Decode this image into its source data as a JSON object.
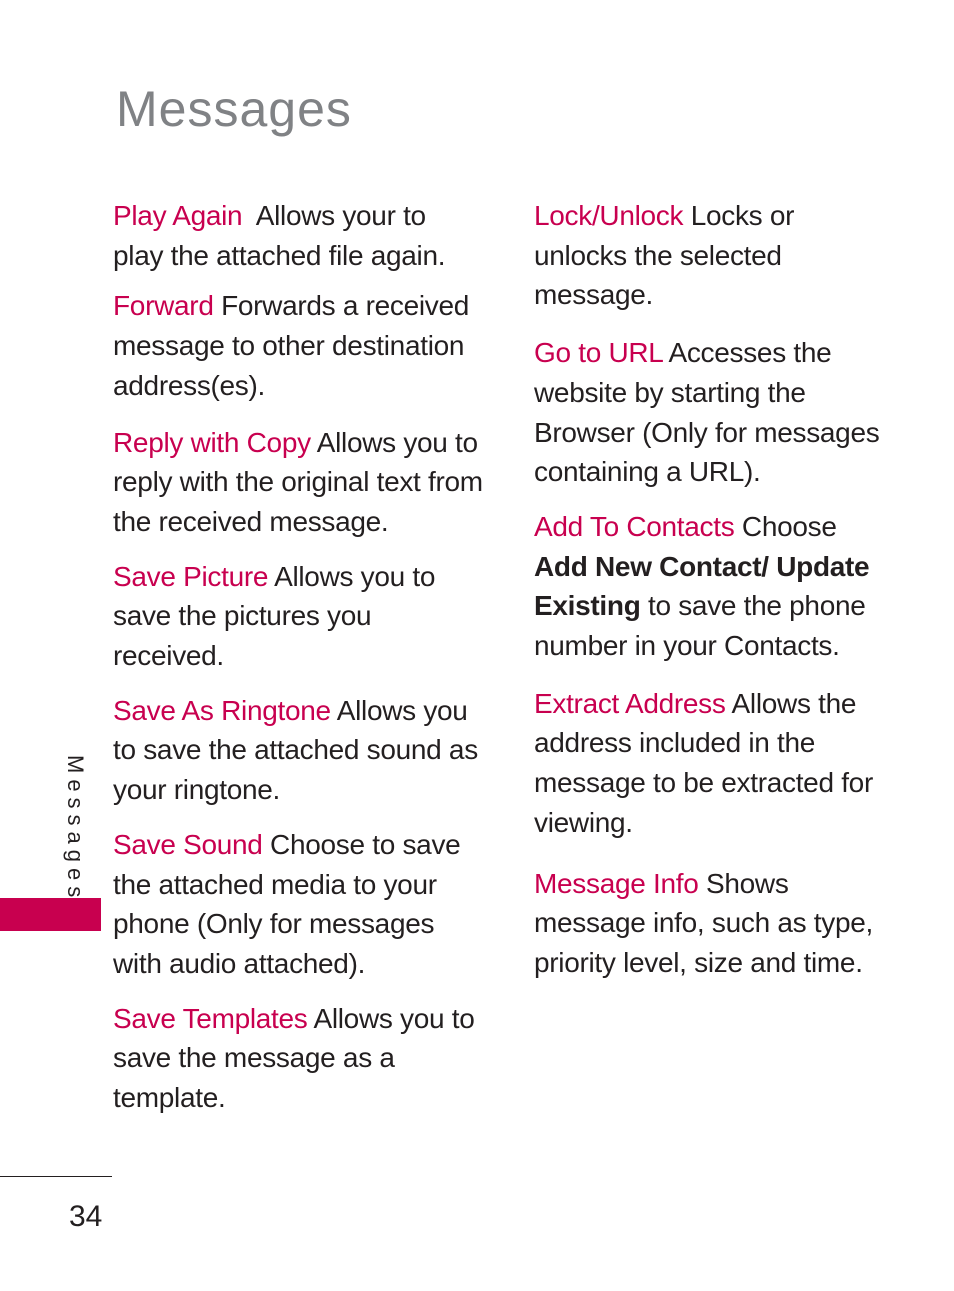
{
  "page": {
    "title": "Messages",
    "side_label": "Messages",
    "page_number": "34",
    "accent_color": "#c8004f"
  },
  "left_column": [
    {
      "term": "Play Again",
      "desc": "  Allows your to play the attached file again."
    },
    {
      "term": "Forward",
      "desc": " Forwards a received message to other destination address(es)."
    },
    {
      "term": "Reply with Copy",
      "desc": " Allows you to reply with the original text from the received message."
    },
    {
      "term": "Save Picture",
      "desc": " Allows you to save the pictures you received."
    },
    {
      "term": "Save As Ringtone",
      "desc": " Allows you to save the attached sound as your ringtone."
    },
    {
      "term": "Save Sound",
      "desc": " Choose to save the attached media to your phone (Only for messages with audio attached)."
    },
    {
      "term": "Save Templates",
      "desc": " Allows you to save the message as a template."
    }
  ],
  "right_column": [
    {
      "term": "Lock/Unlock",
      "desc": " Locks or unlocks the selected message."
    },
    {
      "term": "Go to URL",
      "desc": " Accesses the website by starting the Browser (Only for messages containing a URL)."
    },
    {
      "term": "Add To Contacts",
      "desc_before": " Choose ",
      "bold": "Add New Contact/ Update Existing",
      "desc": " to save the phone number in your Contacts."
    },
    {
      "term": "Extract Address",
      "desc": " Allows the address included in the message to be extracted for viewing."
    },
    {
      "term": "Message Info",
      "desc": " Shows message info, such as type, priority level, size and time."
    }
  ]
}
